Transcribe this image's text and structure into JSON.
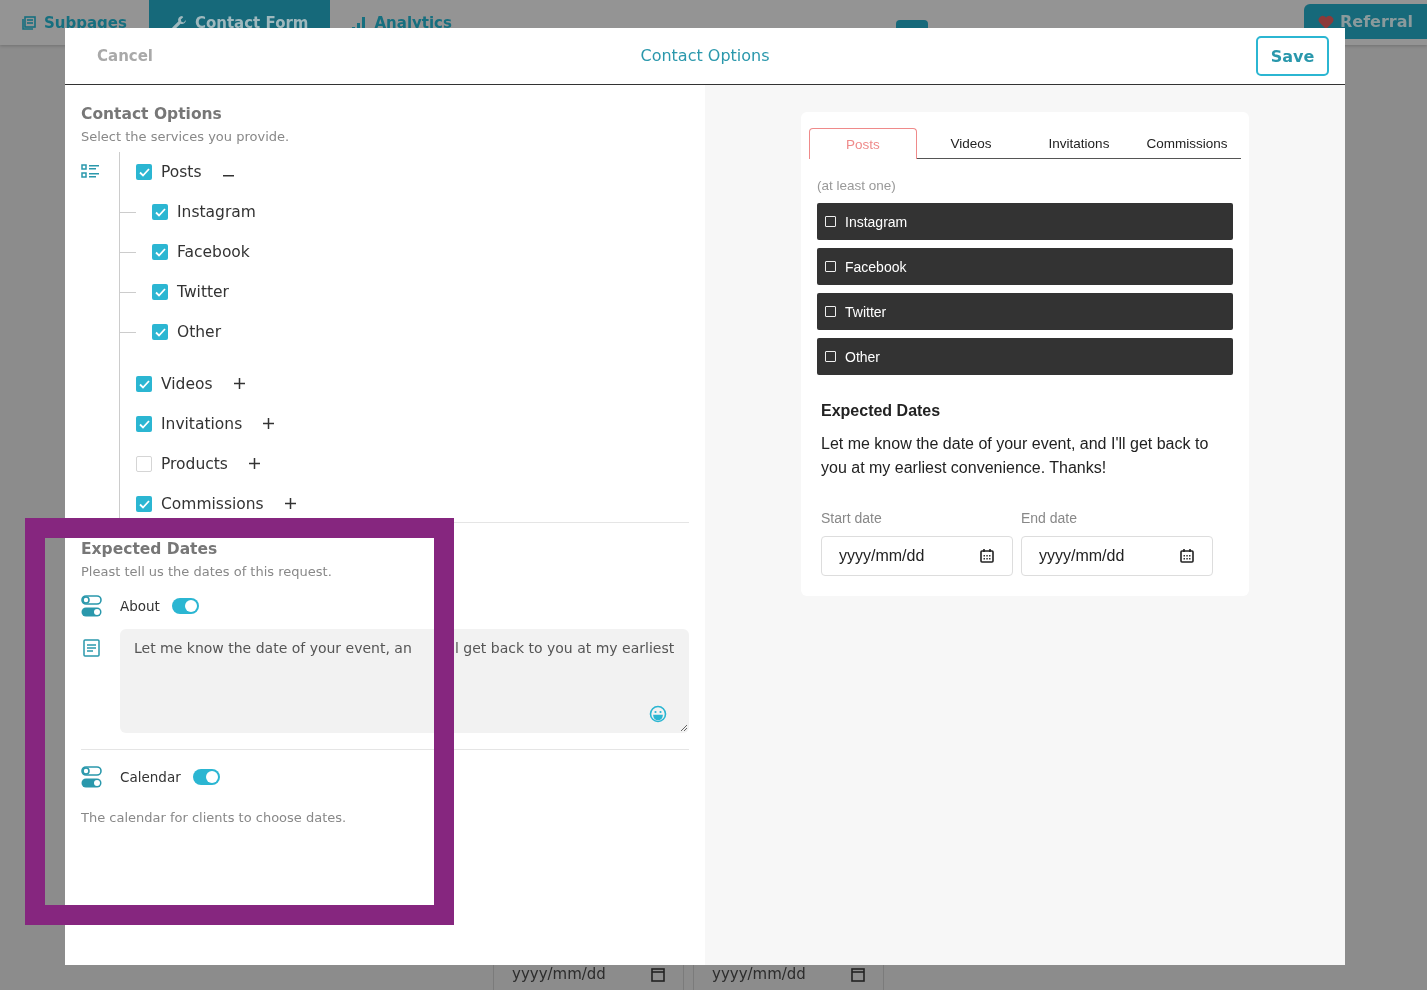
{
  "background": {
    "nav_tabs": [
      {
        "label": "Subpages",
        "selected": false
      },
      {
        "label": "Contact Form",
        "selected": true
      },
      {
        "label": "Analytics",
        "selected": false
      }
    ],
    "referral_button": "Referral",
    "date_fields": [
      {
        "placeholder": "yyyy/mm/dd"
      },
      {
        "placeholder": "yyyy/mm/dd"
      }
    ]
  },
  "modal": {
    "cancel": "Cancel",
    "title": "Contact Options",
    "save": "Save"
  },
  "editor": {
    "contact_options": {
      "title": "Contact Options",
      "subtitle": "Select the services you provide.",
      "items": [
        {
          "label": "Posts",
          "checked": true,
          "expanded": true,
          "children": [
            {
              "label": "Instagram",
              "checked": true
            },
            {
              "label": "Facebook",
              "checked": true
            },
            {
              "label": "Twitter",
              "checked": true
            },
            {
              "label": "Other",
              "checked": true
            }
          ]
        },
        {
          "label": "Videos",
          "checked": true,
          "expanded": false
        },
        {
          "label": "Invitations",
          "checked": true,
          "expanded": false
        },
        {
          "label": "Products",
          "checked": false,
          "expanded": false
        },
        {
          "label": "Commissions",
          "checked": true,
          "expanded": false
        }
      ]
    },
    "expected_dates": {
      "title": "Expected Dates",
      "subtitle": "Pleast tell us the dates of this request.",
      "about": {
        "label": "About",
        "on": true
      },
      "about_text_parts": [
        "Let me know the date of your event, an",
        "l get back to you at my earliest"
      ],
      "calendar": {
        "label": "Calendar",
        "on": true
      },
      "calendar_note": "The calendar for clients to choose dates."
    }
  },
  "preview": {
    "tabs": [
      {
        "label": "Posts",
        "selected": true
      },
      {
        "label": "Videos",
        "selected": false
      },
      {
        "label": "Invitations",
        "selected": false
      },
      {
        "label": "Commissions",
        "selected": false
      }
    ],
    "hint": "(at least one)",
    "options": [
      {
        "label": "Instagram",
        "checked": false
      },
      {
        "label": "Facebook",
        "checked": false
      },
      {
        "label": "Twitter",
        "checked": false
      },
      {
        "label": "Other",
        "checked": false
      }
    ],
    "dates_title": "Expected Dates",
    "dates_text": "Let me know the date of your event, and I'll get back to you at my earliest convenience. Thanks!",
    "date_fields": [
      {
        "label": "Start date",
        "placeholder": "yyyy/mm/dd"
      },
      {
        "label": "End date",
        "placeholder": "yyyy/mm/dd"
      }
    ]
  }
}
